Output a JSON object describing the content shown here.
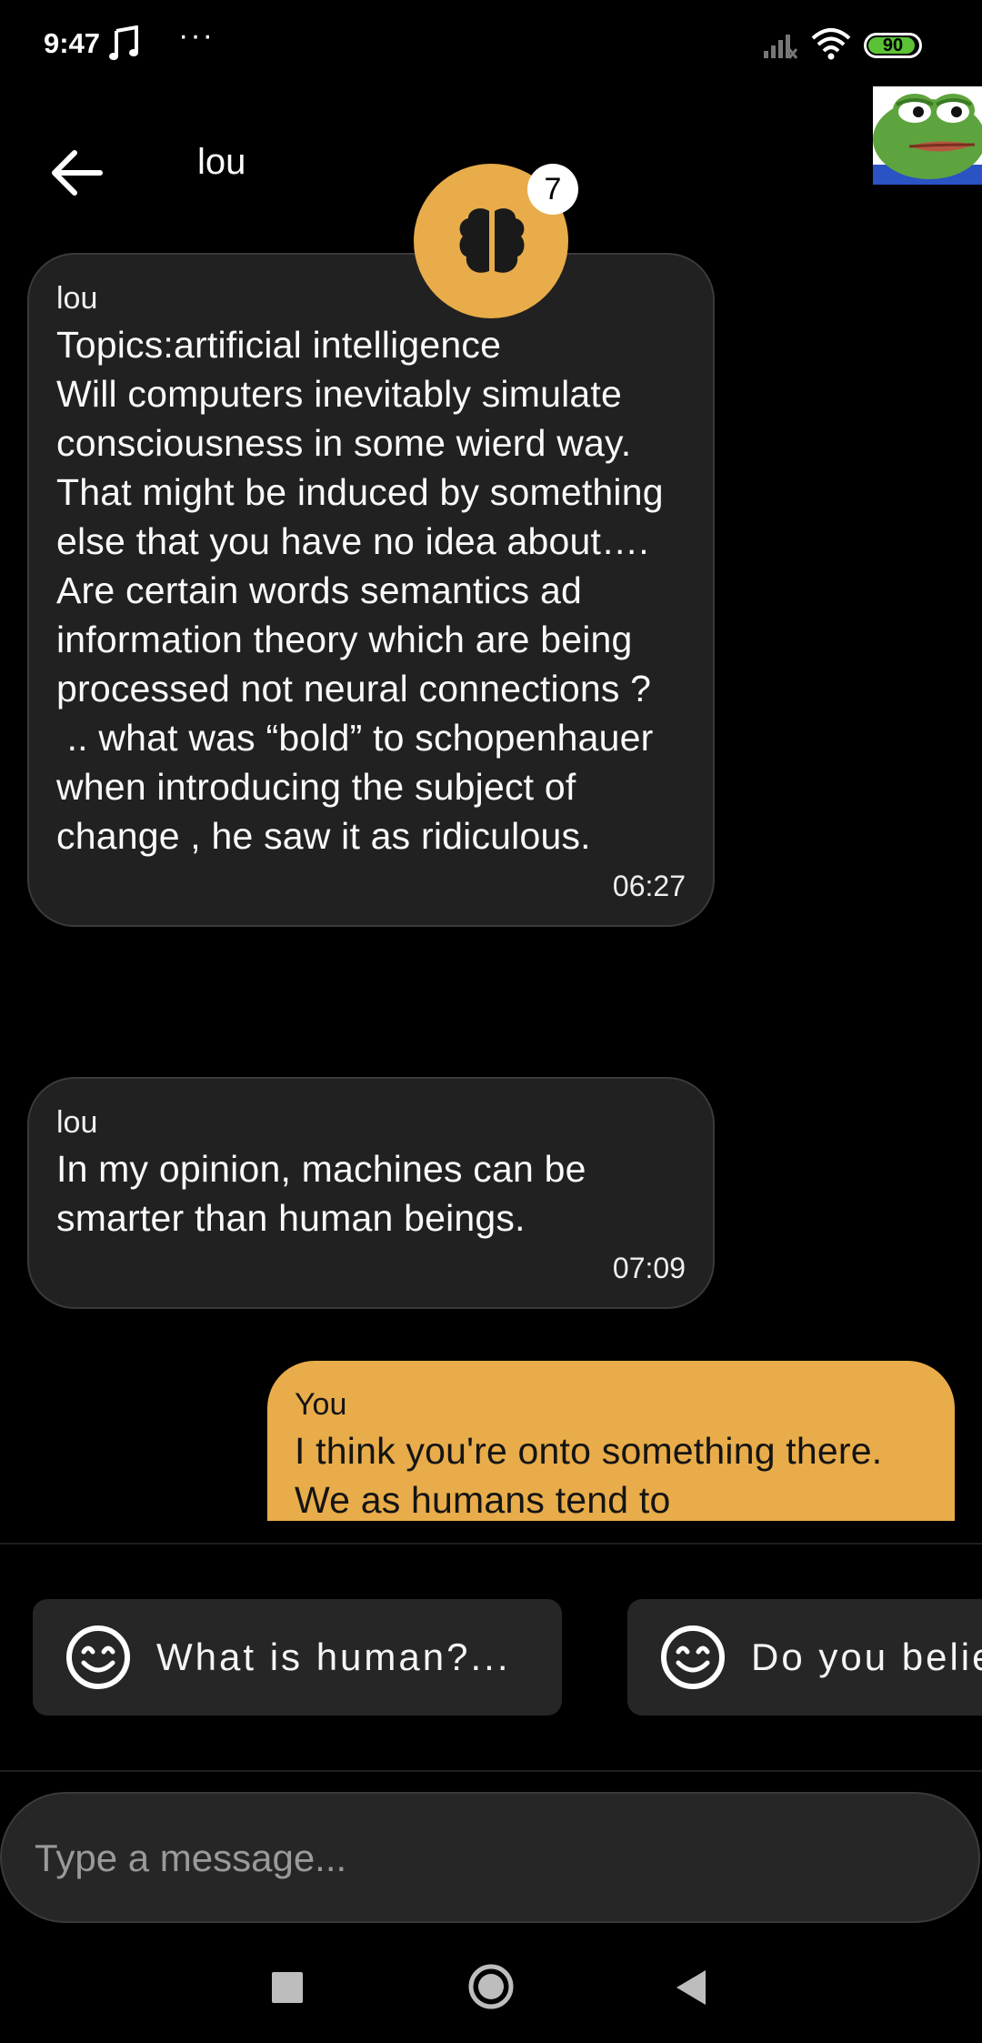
{
  "status_bar": {
    "time": "9:47",
    "music_icon": "music-note-icon",
    "more_icon": "more-dots-icon",
    "battery_level": "90",
    "battery_fraction": 0.9
  },
  "header": {
    "back_icon": "arrow-back-icon",
    "title": "lou"
  },
  "brain_badge": {
    "icon": "brain-icon",
    "count": "7",
    "color": "#e8ac4a"
  },
  "messages": [
    {
      "sender": "lou",
      "text": "Topics:artificial intelligence\nWill computers inevitably simulate consciousness in some wierd way. That might be induced by something else that you have no idea about…. Are certain words semantics ad information theory which are being processed not neural connections ?\n .. what was “bold” to schopenhauer when introducing the subject of change , he saw it as ridiculous.",
      "time": "06:27"
    },
    {
      "sender": "lou",
      "text": "In my opinion, machines can be smarter than human beings.",
      "time": "07:09"
    },
    {
      "sender": "You",
      "text": "I think you're onto something there. We as humans tend to"
    }
  ],
  "suggestions": [
    {
      "icon": "smiley-icon",
      "label": "What is human?..."
    },
    {
      "icon": "smiley-icon",
      "label": "Do you belie"
    }
  ],
  "composer": {
    "placeholder": "Type a message..."
  },
  "colors": {
    "accent": "#e8ac4a",
    "bubble_bg": "#212121",
    "background": "#000000"
  }
}
